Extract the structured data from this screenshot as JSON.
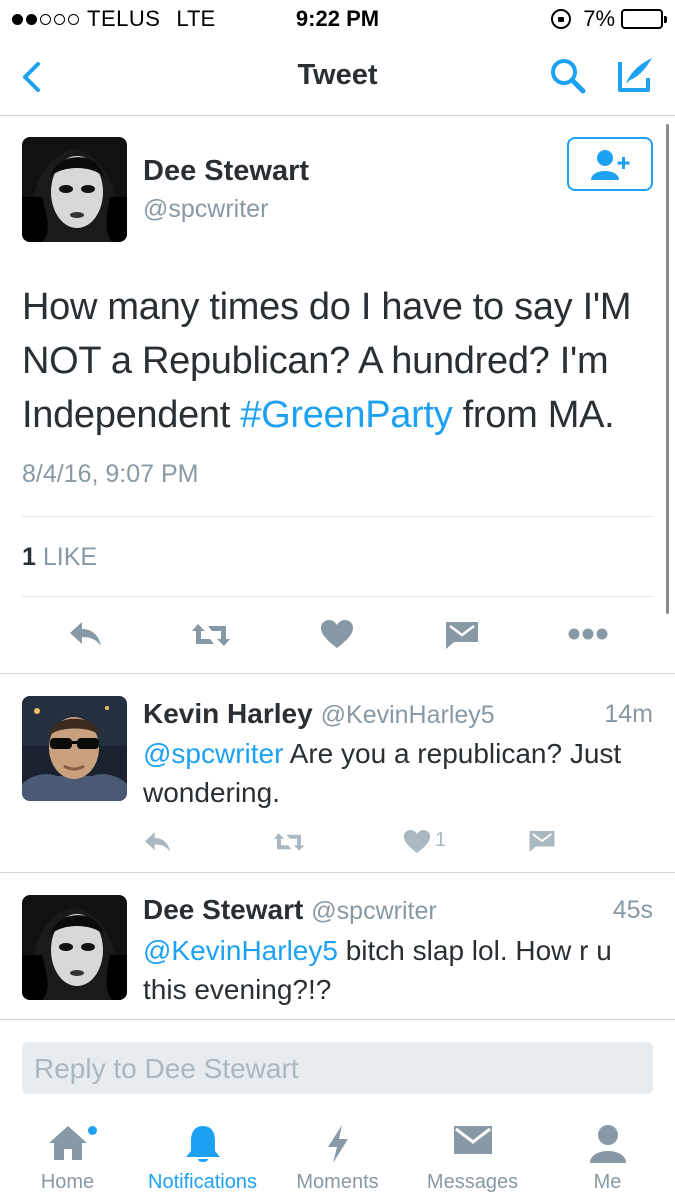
{
  "status_bar": {
    "carrier": "TELUS",
    "network": "LTE",
    "time": "9:22 PM",
    "battery": "7%",
    "signal_bars_filled": 2,
    "signal_bars_total": 5,
    "battery_level": 0.07
  },
  "nav": {
    "title": "Tweet",
    "back_icon": "chevron-left-icon",
    "search_icon": "search-icon",
    "compose_icon": "compose-tweet-icon"
  },
  "tweet": {
    "author_name": "Dee Stewart",
    "author_handle": "@spcwriter",
    "text_before": "How many times do I have to say I'M NOT a Republican? A hundred? I'm Independent ",
    "hashtag": "#GreenParty",
    "text_after": " from MA.",
    "timestamp": "8/4/16, 9:07 PM",
    "like_count": "1",
    "like_label": "LIKE",
    "actions": [
      "reply-icon",
      "retweet-icon",
      "heart-icon",
      "message-icon",
      "more-icon"
    ]
  },
  "replies": [
    {
      "name": "Kevin Harley",
      "handle": "@KevinHarley5",
      "age": "14m",
      "mention": "@spcwriter",
      "text": " Are you a republican? Just wondering.",
      "like_count": "1"
    },
    {
      "name": "Dee Stewart",
      "handle": "@spcwriter",
      "age": "45s",
      "mention": "@KevinHarley5",
      "text": " bitch slap lol. How r u this evening?!?"
    }
  ],
  "reply_field": {
    "placeholder": "Reply to Dee Stewart"
  },
  "tabs": [
    {
      "label": "Home",
      "icon": "home-icon",
      "badge": true
    },
    {
      "label": "Notifications",
      "icon": "bell-icon",
      "active": true
    },
    {
      "label": "Moments",
      "icon": "lightning-icon"
    },
    {
      "label": "Messages",
      "icon": "envelope-icon"
    },
    {
      "label": "Me",
      "icon": "person-icon"
    }
  ],
  "colors": {
    "accent": "#1da1f2",
    "text": "#292f33",
    "secondary": "#8899a6",
    "icon_gray": "#aab8c2"
  }
}
